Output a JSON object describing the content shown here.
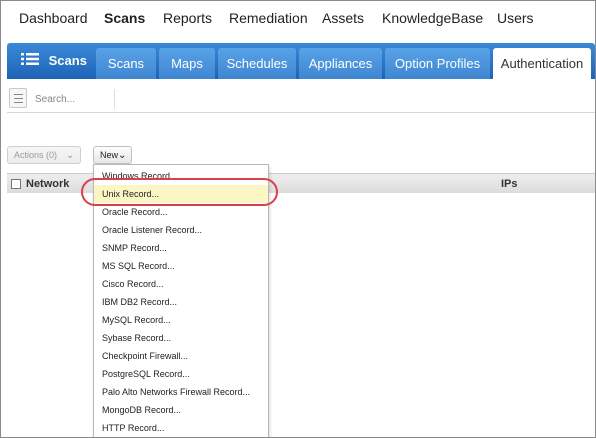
{
  "topnav": {
    "items": [
      {
        "label": "Dashboard",
        "active": false
      },
      {
        "label": "Scans",
        "active": true
      },
      {
        "label": "Reports",
        "active": false
      },
      {
        "label": "Remediation",
        "active": false
      },
      {
        "label": "Assets",
        "active": false
      },
      {
        "label": "KnowledgeBase",
        "active": false
      },
      {
        "label": "Users",
        "active": false
      }
    ]
  },
  "tabbar": {
    "brand": {
      "label": "Scans",
      "icon": "list-icon"
    },
    "tabs": [
      {
        "label": "Scans",
        "active": false
      },
      {
        "label": "Maps",
        "active": false
      },
      {
        "label": "Schedules",
        "active": false
      },
      {
        "label": "Appliances",
        "active": false
      },
      {
        "label": "Option Profiles",
        "active": false
      },
      {
        "label": "Authentication",
        "active": true
      }
    ]
  },
  "search": {
    "placeholder": "Search..."
  },
  "actions": {
    "actions_label": "Actions (0)",
    "new_label": "New"
  },
  "table": {
    "columns": [
      "Network",
      "IPs"
    ]
  },
  "new_menu": {
    "highlighted_index": 1,
    "items": [
      "Windows Record...",
      "Unix Record...",
      "Oracle Record...",
      "Oracle Listener Record...",
      "SNMP Record...",
      "MS SQL Record...",
      "Cisco Record...",
      "IBM DB2 Record...",
      "MySQL Record...",
      "Sybase Record...",
      "Checkpoint Firewall...",
      "PostgreSQL Record...",
      "Palo Alto Networks Firewall Record...",
      "MongoDB Record...",
      "HTTP Record..."
    ]
  },
  "colors": {
    "tab_bar": "#1e63b6",
    "highlight": "#fbf6c4",
    "callout": "#d9414a"
  }
}
